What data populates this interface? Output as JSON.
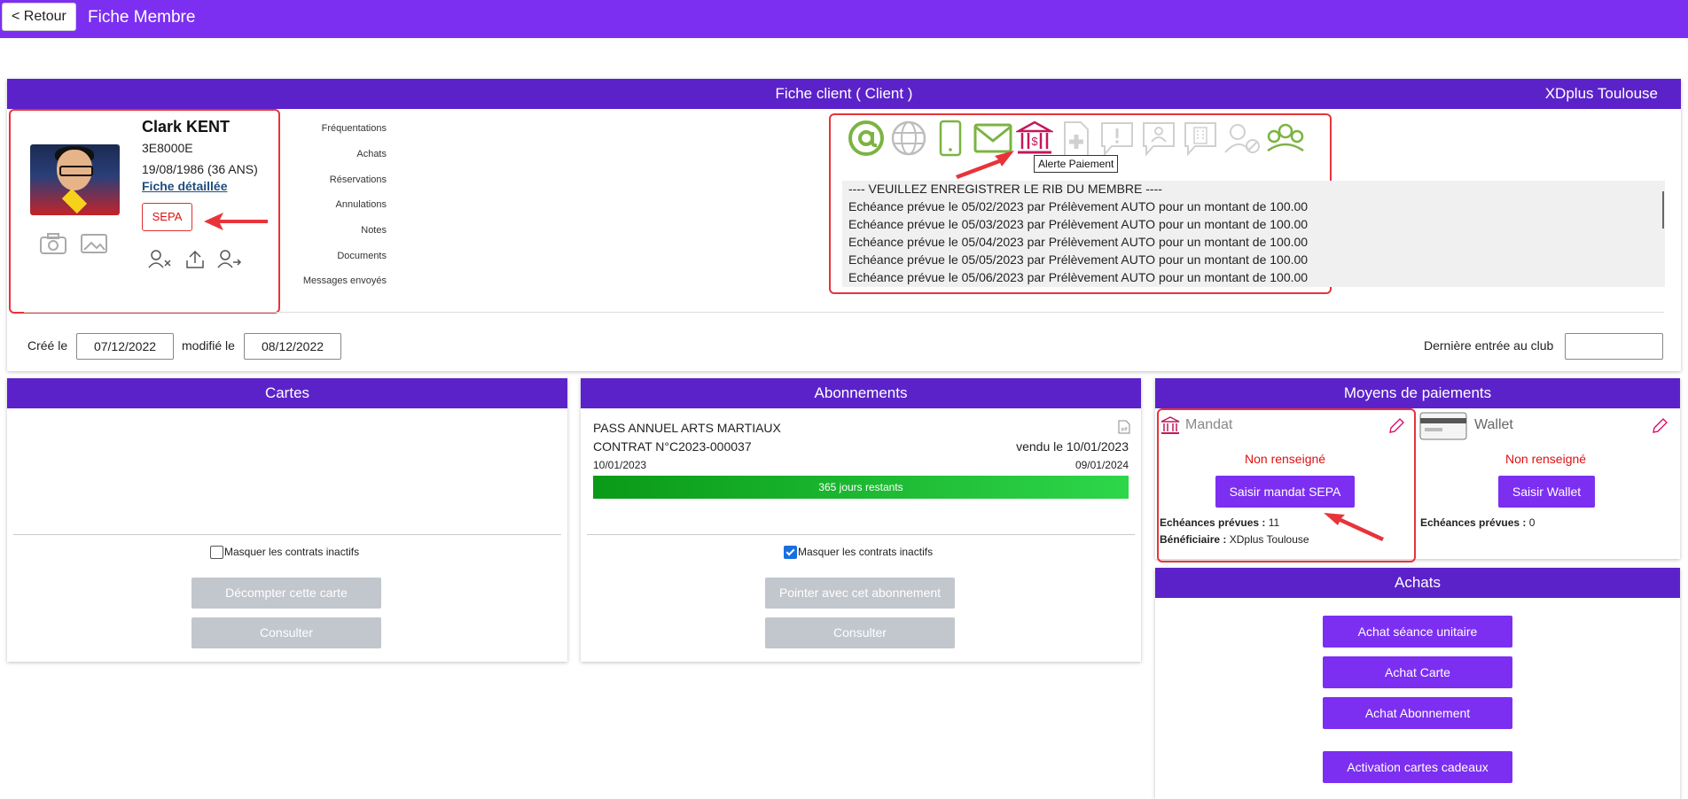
{
  "topbar": {
    "back_label": "< Retour",
    "title": "Fiche Membre"
  },
  "client_panel": {
    "title": "Fiche client ( Client )",
    "club": "XDplus Toulouse"
  },
  "member": {
    "name": "Clark KENT",
    "code": "3E8000E",
    "birth": "19/08/1986 (36 ANS)",
    "detail_link": "Fiche détaillée",
    "sepa_badge": "SEPA"
  },
  "nav": [
    "Fréquentations",
    "Achats",
    "Réservations",
    "Annulations",
    "Notes",
    "Documents",
    "Messages envoyés"
  ],
  "alerts": {
    "icons": [
      "email-at-icon",
      "web-icon",
      "mobile-icon",
      "mail-envelope-icon",
      "bank-payment-icon",
      "medical-doc-icon",
      "alert-message-icon",
      "contact-card-icon",
      "building-icon",
      "user-blocked-icon",
      "group-icon"
    ],
    "tooltip": "Alerte Paiement",
    "messages": [
      "---- VEUILLEZ ENREGISTRER LE RIB DU MEMBRE ----",
      "Echéance prévue le 05/02/2023 par Prélèvement AUTO pour un montant de 100.00",
      "Echéance prévue le 05/03/2023 par Prélèvement AUTO pour un montant de 100.00",
      "Echéance prévue le 05/04/2023 par Prélèvement AUTO pour un montant de 100.00",
      "Echéance prévue le 05/05/2023 par Prélèvement AUTO pour un montant de 100.00",
      "Echéance prévue le 05/06/2023 par Prélèvement AUTO pour un montant de 100.00"
    ]
  },
  "meta": {
    "created_label": "Créé le",
    "created_value": "07/12/2022",
    "modified_label": "modifié le",
    "modified_value": "08/12/2022",
    "last_entry_label": "Dernière entrée au club",
    "last_entry_value": ""
  },
  "cartes": {
    "title": "Cartes",
    "hide_inactive_label": "Masquer les contrats inactifs",
    "hide_inactive_checked": false,
    "decompter_label": "Décompter cette carte",
    "consulter_label": "Consulter"
  },
  "abonnements": {
    "title": "Abonnements",
    "contract": {
      "name": "PASS ANNUEL ARTS MARTIAUX",
      "number": "CONTRAT N°C2023-000037",
      "sold": "vendu le 10/01/2023",
      "start": "10/01/2023",
      "end": "09/01/2024",
      "remaining": "365 jours restants",
      "remaining_fraction": 1.0
    },
    "hide_inactive_label": "Masquer les contrats inactifs",
    "hide_inactive_checked": true,
    "pointer_label": "Pointer avec cet abonnement",
    "consulter_label": "Consulter"
  },
  "paiements": {
    "title": "Moyens de paiements",
    "mandat": {
      "title": "Mandat",
      "status": "Non renseigné",
      "button": "Saisir mandat SEPA",
      "echeances_label": "Echéances prévues :",
      "echeances_value": "11",
      "beneficiaire_label": "Bénéficiaire :",
      "beneficiaire_value": "XDplus Toulouse"
    },
    "wallet": {
      "title": "Wallet",
      "status": "Non renseigné",
      "button": "Saisir Wallet",
      "echeances_label": "Echéances prévues :",
      "echeances_value": "0"
    }
  },
  "achats": {
    "title": "Achats",
    "buttons": [
      "Achat séance unitaire",
      "Achat Carte",
      "Achat Abonnement",
      "Activation cartes cadeaux"
    ]
  },
  "colors": {
    "brand": "#7c2ff1",
    "header": "#5b22c9",
    "alert_red": "#e8333a",
    "icon_green": "#7cb342",
    "icon_gray": "#bdbdbd",
    "bank_icon": "#c2185b"
  }
}
